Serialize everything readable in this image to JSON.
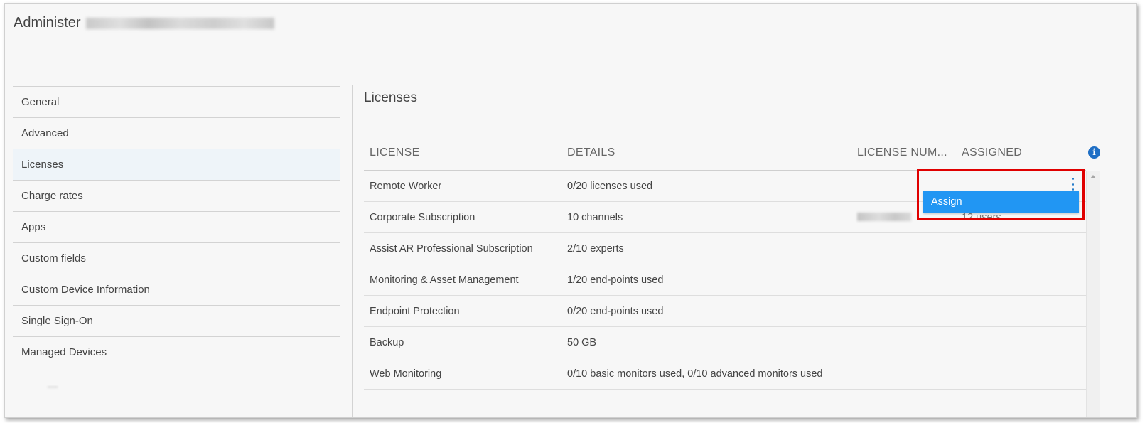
{
  "page": {
    "title": "Administer"
  },
  "sidebar": {
    "items": [
      {
        "label": "General"
      },
      {
        "label": "Advanced"
      },
      {
        "label": "Licenses"
      },
      {
        "label": "Charge rates"
      },
      {
        "label": "Apps"
      },
      {
        "label": "Custom fields"
      },
      {
        "label": "Custom Device Information"
      },
      {
        "label": "Single Sign-On"
      },
      {
        "label": "Managed Devices"
      }
    ],
    "active": "Licenses"
  },
  "main": {
    "title": "Licenses",
    "columns": {
      "license": "LICENSE",
      "details": "DETAILS",
      "license_number": "LICENSE NUM...",
      "assigned": "ASSIGNED"
    },
    "info_icon": "info-icon",
    "rows": [
      {
        "license": "Remote Worker",
        "details": "0/20 licenses used",
        "assigned": ""
      },
      {
        "license": "Corporate Subscription",
        "details": "10 channels",
        "assigned": "12 users"
      },
      {
        "license": "Assist AR Professional Subscription",
        "details": "2/10 experts",
        "assigned": ""
      },
      {
        "license": "Monitoring & Asset Management",
        "details": "1/20 end-points used",
        "assigned": ""
      },
      {
        "license": "Endpoint Protection",
        "details": "0/20 end-points used",
        "assigned": ""
      },
      {
        "license": "Backup",
        "details": "50 GB",
        "assigned": ""
      },
      {
        "license": "Web Monitoring",
        "details": "0/10 basic monitors used, 0/10 advanced monitors used",
        "assigned": ""
      }
    ]
  },
  "row_menu": {
    "icon": "kebab-menu-icon",
    "assign_label": "Assign",
    "highlight_color": "#e00000",
    "accent_color": "#2196f3"
  }
}
